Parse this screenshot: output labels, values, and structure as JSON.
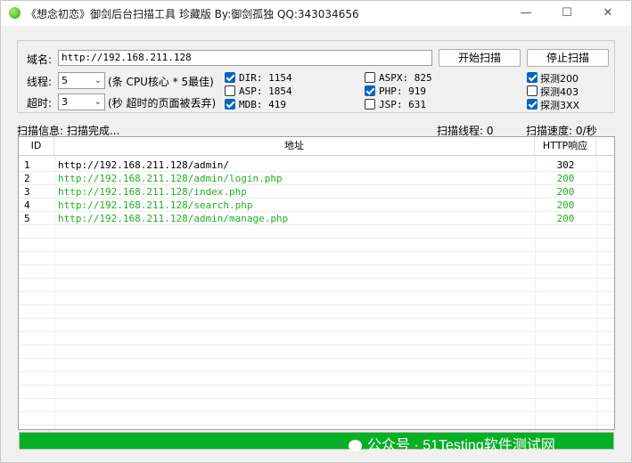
{
  "window": {
    "title": "《想念初恋》御剑后台扫描工具 珍藏版 By:御剑孤独 QQ:343034656",
    "minimize": "—",
    "maximize": "☐",
    "close": "✕"
  },
  "form": {
    "domain_label": "域名:",
    "domain_value": "http://192.168.211.128",
    "threads_label": "线程:",
    "threads_value": "5",
    "threads_hint": "(条 CPU核心 * 5最佳)",
    "timeout_label": "超时:",
    "timeout_value": "3",
    "timeout_hint": "(秒 超时的页面被丢弃)",
    "start_button": "开始扫描",
    "stop_button": "停止扫描"
  },
  "options": [
    {
      "label": "DIR: 1154",
      "checked": true
    },
    {
      "label": "ASP: 1854",
      "checked": false
    },
    {
      "label": "MDB: 419",
      "checked": true
    },
    {
      "label": "ASPX: 825",
      "checked": false
    },
    {
      "label": "PHP: 919",
      "checked": true
    },
    {
      "label": "JSP: 631",
      "checked": false
    },
    {
      "label": "探测200",
      "checked": true
    },
    {
      "label": "探测403",
      "checked": false
    },
    {
      "label": "探测3XX",
      "checked": true
    }
  ],
  "status": {
    "info": "扫描信息: 扫描完成...",
    "threads": "扫描线程: 0",
    "speed": "扫描速度: 0/秒"
  },
  "table": {
    "columns": [
      "ID",
      "地址",
      "HTTP响应"
    ],
    "rows": [
      {
        "id": "1",
        "url": "http://192.168.211.128/admin/",
        "code": "302",
        "color": "#000000"
      },
      {
        "id": "2",
        "url": "http://192.168.211.128/admin/login.php",
        "code": "200",
        "color": "#22b022"
      },
      {
        "id": "3",
        "url": "http://192.168.211.128/index.php",
        "code": "200",
        "color": "#22b022"
      },
      {
        "id": "4",
        "url": "http://192.168.211.128/search.php",
        "code": "200",
        "color": "#22b022"
      },
      {
        "id": "5",
        "url": "http://192.168.211.128/admin/manage.php",
        "code": "200",
        "color": "#22b022"
      }
    ]
  },
  "progress": {
    "value": 1.0,
    "color": "#06b025"
  },
  "watermark": "公众号 · 51Testing软件测试网"
}
